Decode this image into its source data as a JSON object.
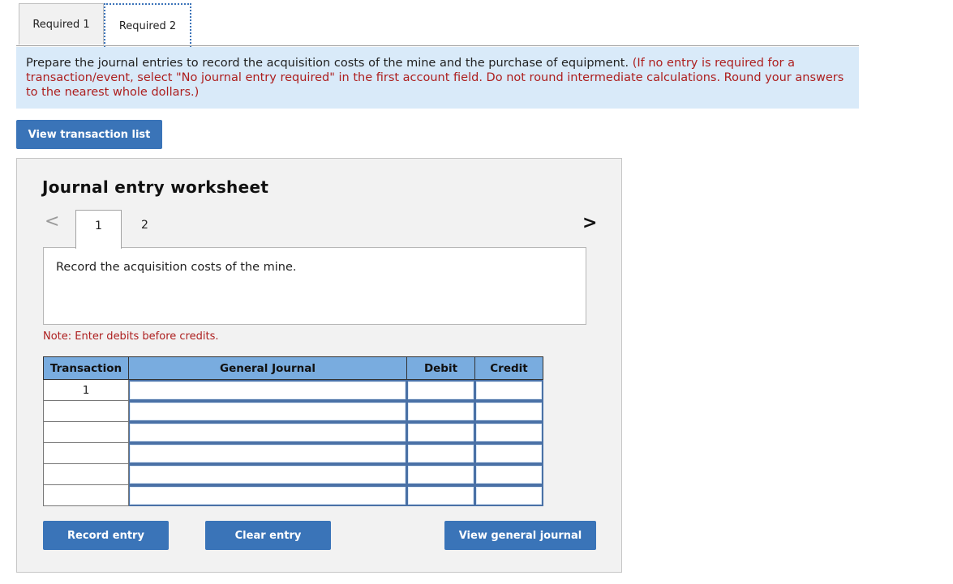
{
  "tabs": [
    {
      "label": "Required 1",
      "active": false
    },
    {
      "label": "Required 2",
      "active": true
    }
  ],
  "instructions": {
    "main": "Prepare the journal entries to record the acquisition costs of the mine and the purchase of equipment. ",
    "note": "(If no entry is required for a transaction/event, select \"No journal entry required\" in the first account field. Do not round intermediate calculations. Round your answers to the nearest whole dollars.)"
  },
  "buttons": {
    "view_transaction_list": "View transaction list",
    "record_entry": "Record entry",
    "clear_entry": "Clear entry",
    "view_general_journal": "View general journal"
  },
  "worksheet": {
    "title": "Journal entry worksheet",
    "prev_icon": "chevron-left",
    "next_icon": "chevron-right",
    "prev_glyph": "<",
    "next_glyph": ">",
    "steps": [
      "1",
      "2"
    ],
    "active_step": "1",
    "description": "Record the acquisition costs of the mine.",
    "note": "Note: Enter debits before credits."
  },
  "journal_table": {
    "headers": [
      "Transaction",
      "General Journal",
      "Debit",
      "Credit"
    ],
    "rows": [
      {
        "transaction": "1",
        "account": "",
        "debit": "",
        "credit": ""
      },
      {
        "transaction": "",
        "account": "",
        "debit": "",
        "credit": ""
      },
      {
        "transaction": "",
        "account": "",
        "debit": "",
        "credit": ""
      },
      {
        "transaction": "",
        "account": "",
        "debit": "",
        "credit": ""
      },
      {
        "transaction": "",
        "account": "",
        "debit": "",
        "credit": ""
      },
      {
        "transaction": "",
        "account": "",
        "debit": "",
        "credit": ""
      }
    ]
  },
  "colors": {
    "button_blue": "#3a74b8",
    "header_blue": "#79acdf",
    "instruction_bg": "#d9eaf9",
    "note_red": "#ad1f1f",
    "panel_bg": "#f2f2f2"
  }
}
